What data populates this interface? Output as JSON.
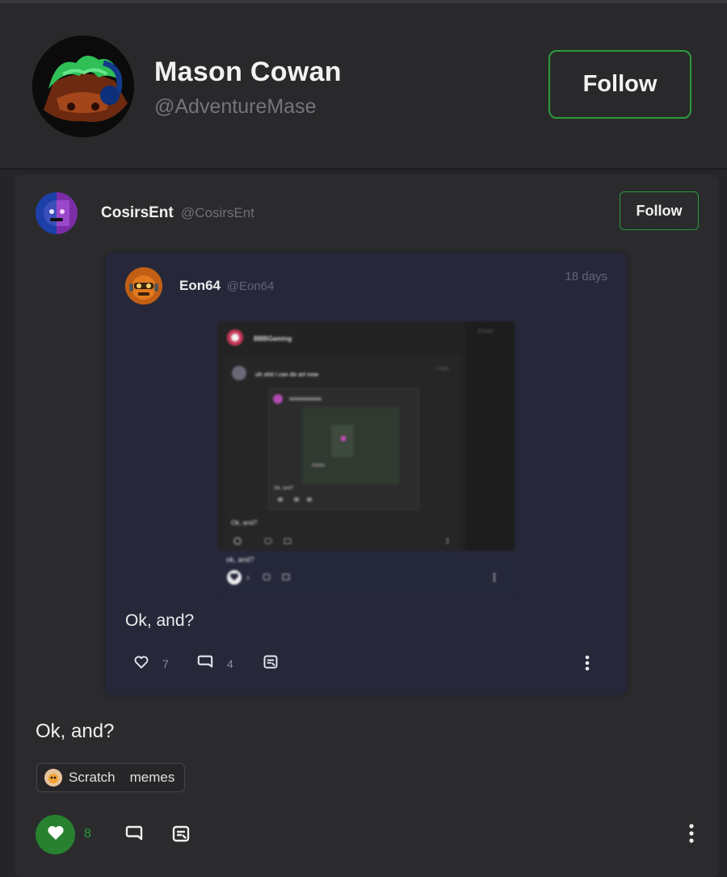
{
  "profile": {
    "name": "Mason Cowan",
    "handle": "@AdventureMase",
    "follow_label": "Follow"
  },
  "post": {
    "author": "CosirsEnt",
    "handle": "@CosirsEnt",
    "follow_label": "Follow",
    "text": "Ok, and?",
    "tags": [
      "Scratch",
      "memes"
    ],
    "likes": "8",
    "liked": true,
    "quote": {
      "author": "Eon64",
      "handle": "@Eon64",
      "time": "18 days",
      "text": "Ok, and?",
      "likes": "7",
      "comments": "4",
      "embedded": {
        "author": "BBBGaming",
        "time": "Cross",
        "inner_author": "uh shit i can do art now",
        "inner_time": "1 days",
        "inner_text": "Ok, and?",
        "deep_text": "Ok, and?",
        "text": "ok, and?",
        "likes": "8"
      }
    }
  },
  "colors": {
    "accent_green": "#2a9b3a",
    "background": "#252527",
    "card": "#2b2b2e",
    "quote_card": "#26283a"
  }
}
